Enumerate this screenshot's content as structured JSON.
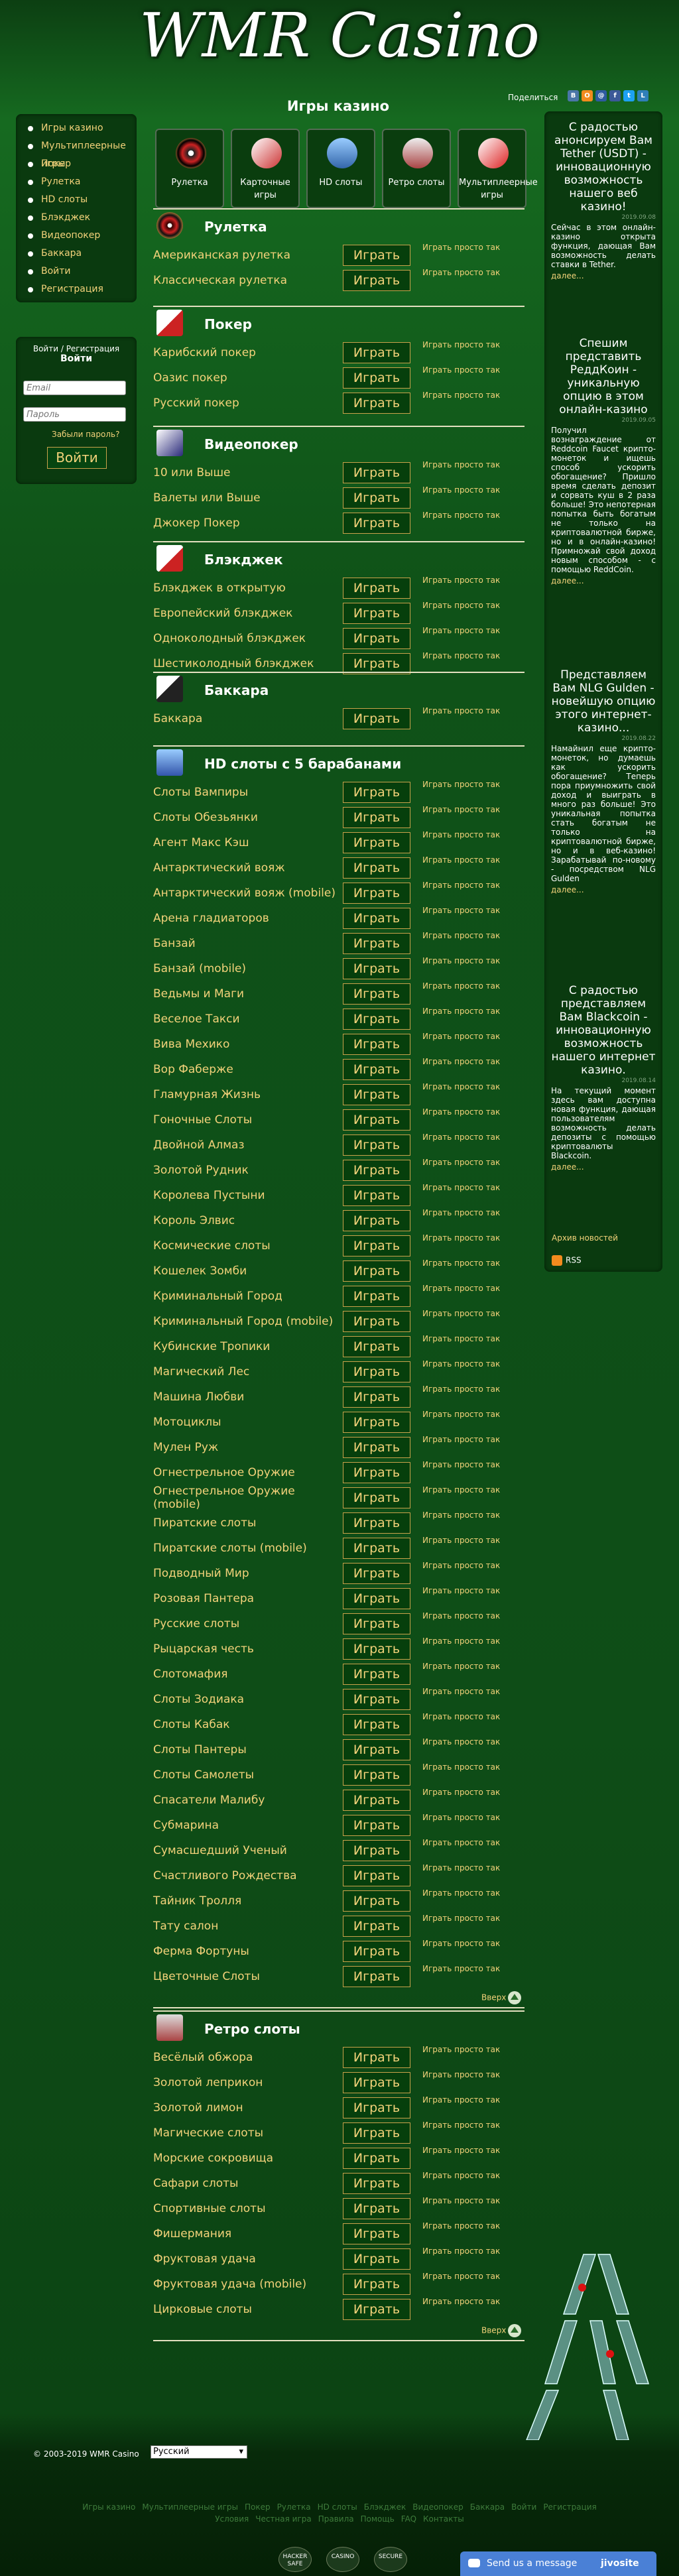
{
  "site": {
    "logo": "WMR Casino",
    "share_label": "Поделиться"
  },
  "share_icons": [
    {
      "name": "vkontakte-icon",
      "glyph": "B",
      "color": "#4a76a8"
    },
    {
      "name": "odnoklassniki-icon",
      "glyph": "O",
      "color": "#f28b1e"
    },
    {
      "name": "mailru-icon",
      "glyph": "@",
      "color": "#2d5aa0"
    },
    {
      "name": "facebook-icon",
      "glyph": "f",
      "color": "#3b5998"
    },
    {
      "name": "twitter-icon",
      "glyph": "t",
      "color": "#1da1f2"
    },
    {
      "name": "livejournal-icon",
      "glyph": "L",
      "color": "#2f7fb8"
    }
  ],
  "left_menu": [
    "Игры казино",
    "Мультиплеерные игры",
    "Покер",
    "Рулетка",
    "HD слоты",
    "Блэкджек",
    "Видеопокер",
    "Баккара",
    "Войти",
    "Регистрация"
  ],
  "login": {
    "link1": "Войти",
    "sep": " / ",
    "link2": "Регистрация",
    "heading": "Войти",
    "email_placeholder": "Email",
    "password_placeholder": "Пароль",
    "forgot": "Забыли пароль?",
    "button": "Войти"
  },
  "main": {
    "title": "Игры казино",
    "play_label": "Играть",
    "free_label": "Играть просто так",
    "up_label": "Вверх"
  },
  "categories": [
    {
      "label": "Рулетка",
      "icon": "roulette-wheel-icon"
    },
    {
      "label": "Карточные игры",
      "icon": "playing-cards-icon"
    },
    {
      "label": "HD слоты",
      "icon": "hd-slots-icon"
    },
    {
      "label": "Ретро слоты",
      "icon": "retro-slots-icon"
    },
    {
      "label": "Мультиплеерные игры",
      "icon": "multiplayer-icon"
    }
  ],
  "sections": [
    {
      "title": "Рулетка",
      "icon": "roulette-wheel-icon",
      "games": [
        "Американская рулетка",
        "Классическая рулетка"
      ]
    },
    {
      "title": "Покер",
      "icon": "poker-cards-icon",
      "games": [
        "Карибский покер",
        "Оазис покер",
        "Русский покер"
      ]
    },
    {
      "title": "Видеопокер",
      "icon": "videopoker-icon",
      "games": [
        "10 или Выше",
        "Валеты или Выше",
        "Джокер Покер"
      ]
    },
    {
      "title": "Блэкджек",
      "icon": "blackjack-cards-icon",
      "games": [
        "Блэкджек в открытую",
        "Европейский блэкджек",
        "Одноколодный блэкджек",
        "Шестиколодный блэкджек"
      ]
    },
    {
      "title": "Баккара",
      "icon": "baccarat-icon",
      "games": [
        "Баккара"
      ]
    },
    {
      "title": "HD слоты с 5 барабанами",
      "icon": "hd-slots-icon",
      "up": true,
      "games": [
        "Слоты Вампиры",
        "Слоты Обезьянки",
        "Агент Макс Кэш",
        "Антарктический вояж",
        "Антарктический вояж (mobile)",
        "Арена гладиаторов",
        "Банзай",
        "Банзай (mobile)",
        "Ведьмы и Маги",
        "Веселое Такси",
        "Вива Мехико",
        "Вор Фаберже",
        "Гламурная Жизнь",
        "Гоночные Слоты",
        "Двойной Алмаз",
        "Золотой Рудник",
        "Королева Пустыни",
        "Король Элвис",
        "Космические слоты",
        "Кошелек Зомби",
        "Криминальный Город",
        "Криминальный Город (mobile)",
        "Кубинские Тропики",
        "Магический Лес",
        "Машина Любви",
        "Мотоциклы",
        "Мулен Руж",
        "Огнестрельное Оружие",
        "Огнестрельное Оружие (mobile)",
        "Пиратские слоты",
        "Пиратские слоты (mobile)",
        "Подводный Мир",
        "Розовая Пантера",
        "Русские слоты",
        "Рыцарская честь",
        "Слотомафия",
        "Слоты Зодиака",
        "Слоты Кабак",
        "Слоты Пантеры",
        "Слоты Самолеты",
        "Спасатели Малибу",
        "Субмарина",
        "Сумасшедший Ученый",
        "Счастливого Рождества",
        "Тайник Тролля",
        "Тату салон",
        "Ферма Фортуны",
        "Цветочные Слоты"
      ]
    },
    {
      "title": "Ретро слоты",
      "icon": "retro-slots-icon",
      "up": true,
      "games": [
        "Весёлый обжора",
        "Золотой леприкон",
        "Золотой лимон",
        "Магические слоты",
        "Морские сокровища",
        "Сафари слоты",
        "Спортивные слоты",
        "Фишермания",
        "Фруктовая удача",
        "Фруктовая удача (mobile)",
        "Цирковые слоты"
      ]
    }
  ],
  "news": [
    {
      "title": "С радостью анонсируем Вам Tether (USDT) - инновационную возможность нашего веб казино!",
      "date": "2019.09.08",
      "text": "Сейчас в этом онлайн-казино открыта функция, дающая Вам возможность делать ставки в Tether.",
      "more": "далее..."
    },
    {
      "title": "Спешим представить РеддКоин - уникальную опцию в этом онлайн-казино",
      "date": "2019.09.05",
      "text": "Получил вознаграждение от Reddcoin Faucet крипто-монеток и ищешь способ ускорить обогащение? Пришло время сделать депозит и сорвать куш в 2 раза больше! Это непотерная попытка быть богатым не только на криптовалютной бирже, но и в онлайн-казино! Примножай свой доход новым способом - с помощью ReddCoin.",
      "more": "далее..."
    },
    {
      "title": "Представляем Вам NLG Gulden - новейшую опцию этого интернет-казино...",
      "date": "2019.08.22",
      "text": "Намайнил еще крипто-монеток, но думаешь как ускорить обогащение? Теперь пора приумножить свой доход и выиграть в много раз больше! Это уникальная попытка стать богатым не только на криптовалютной бирже, но и в веб-казино! Зарабатывай по-новому - посредством NLG Gulden",
      "more": "далее..."
    },
    {
      "title": "С радостью представляем Вам Blackcoin - инновационную возможность нашего интернет казино.",
      "date": "2019.08.14",
      "text": "На текущий момент здесь вам доступна новая функция, дающая пользователям возможность делать депозиты с помощью криптовалюты Blackcoin.",
      "more": "далее..."
    }
  ],
  "news_archive": "Архив новостей",
  "rss": "RSS",
  "footer": {
    "copyright": "© 2003-2019 WMR Casino",
    "language": "Русский",
    "links_row1": [
      "Игры казино",
      "Мультиплеерные игры",
      "Покер",
      "Рулетка",
      "HD слоты",
      "Блэкджек",
      "Видеопокер",
      "Баккара",
      "Войти",
      "Регистрация"
    ],
    "links_row2": [
      "Условия",
      "Честная игра",
      "Правила",
      "Помощь",
      "FAQ",
      "Контакты"
    ],
    "badges": [
      "HACKER SAFE",
      "CASINO",
      "SECURE"
    ],
    "chat_text": "Send us a message",
    "chat_brand": "jivosite"
  }
}
